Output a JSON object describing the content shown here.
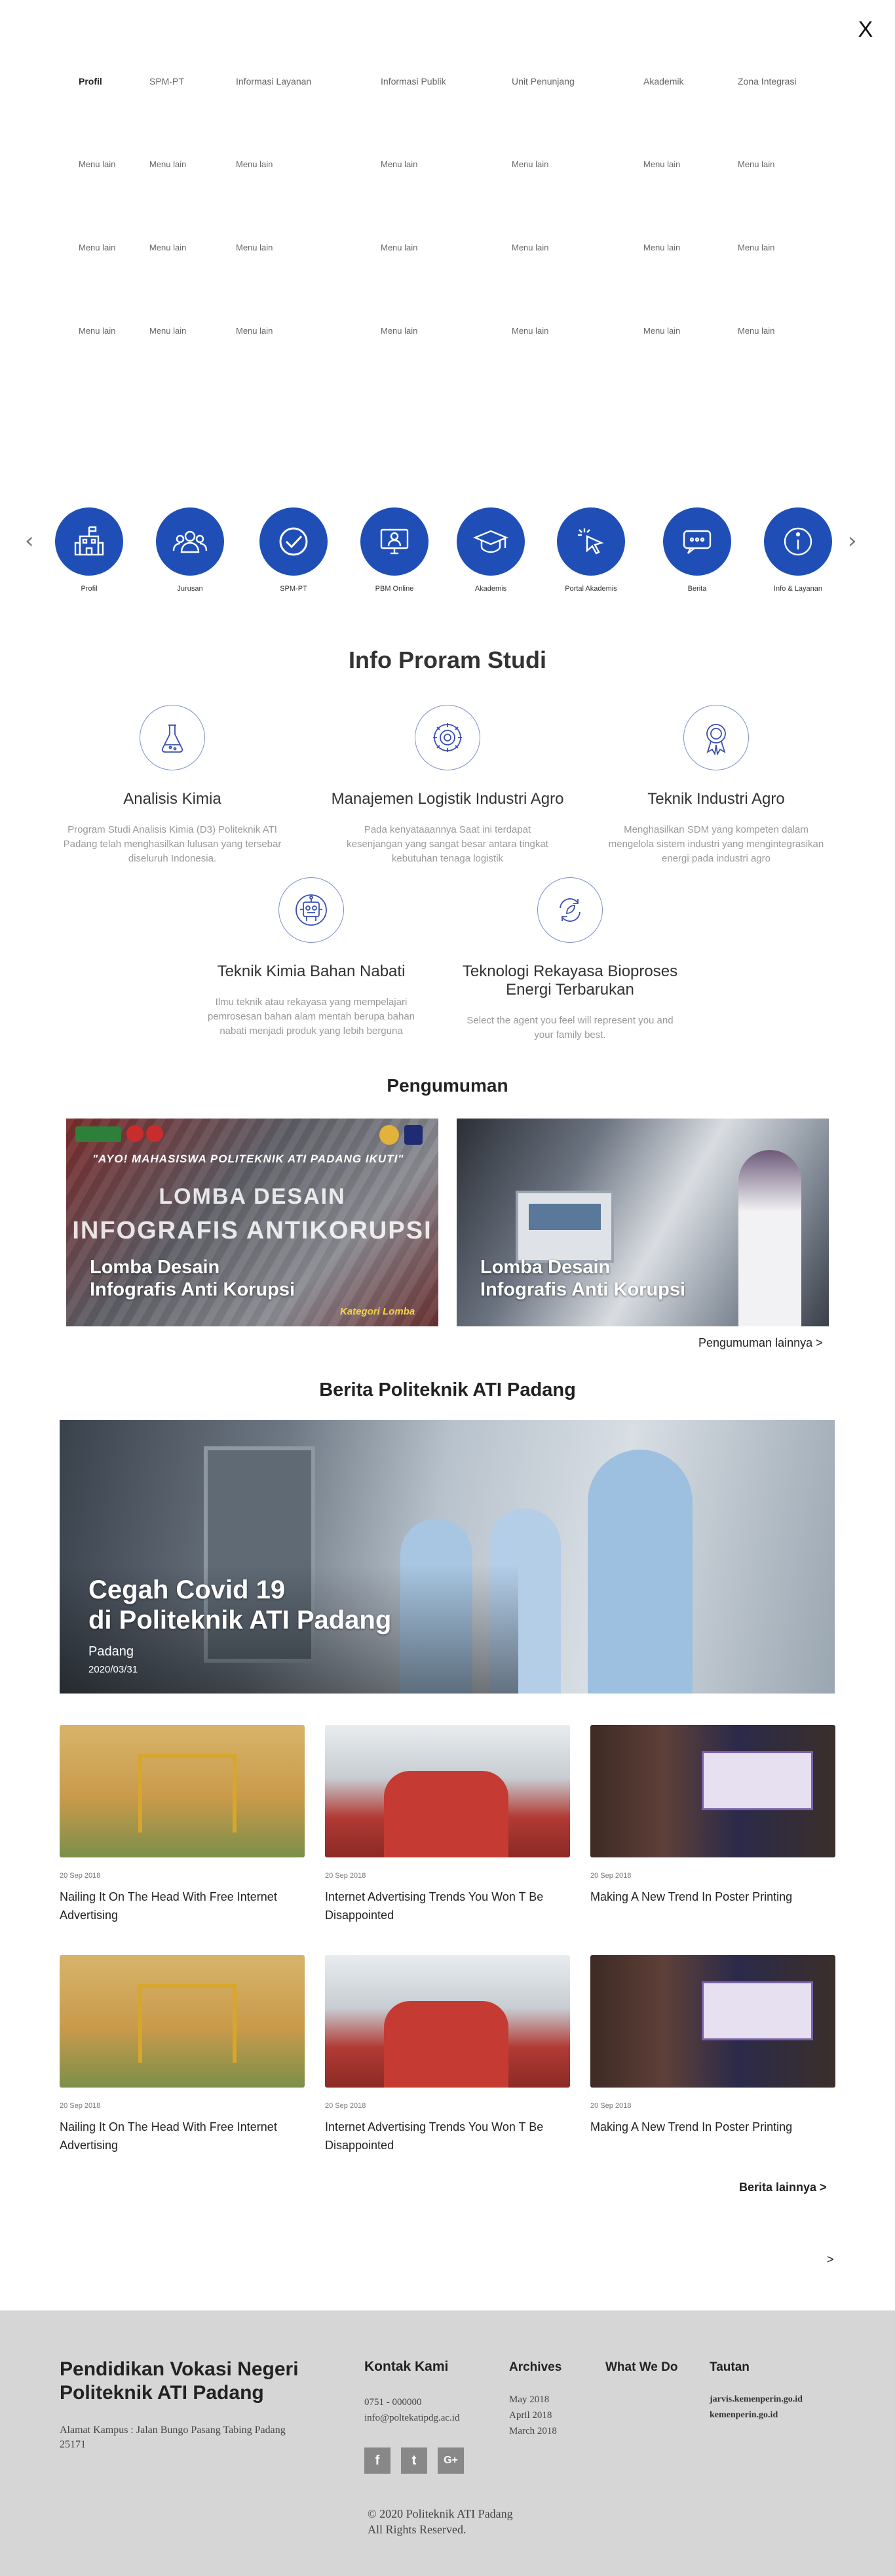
{
  "menu": {
    "close": "X",
    "columns": [
      {
        "head": "Profil",
        "active": true,
        "items": [
          "Menu lain",
          "Menu lain",
          "Menu lain"
        ]
      },
      {
        "head": "SPM-PT",
        "items": [
          "Menu lain",
          "Menu lain",
          "Menu lain"
        ]
      },
      {
        "head": "Informasi Layanan",
        "items": [
          "Menu lain",
          "Menu lain",
          "Menu lain"
        ]
      },
      {
        "head": "Informasi Publik",
        "items": [
          "Menu lain",
          "Menu lain",
          "Menu lain"
        ]
      },
      {
        "head": "Unit Penunjang",
        "items": [
          "Menu lain",
          "Menu lain",
          "Menu lain"
        ]
      },
      {
        "head": "Akademik",
        "items": [
          "Menu lain",
          "Menu lain",
          "Menu lain"
        ]
      },
      {
        "head": "Zona Integrasi",
        "items": [
          "Menu lain",
          "Menu lain",
          "Menu lain"
        ]
      }
    ]
  },
  "quick_links": {
    "prev": "‹",
    "next": "›",
    "items": [
      {
        "label": "Profil",
        "icon": "building-icon"
      },
      {
        "label": "Jurusan",
        "icon": "people-icon"
      },
      {
        "label": "SPM-PT",
        "icon": "check-icon"
      },
      {
        "label": "PBM Online",
        "icon": "computer-user-icon"
      },
      {
        "label": "Akademis",
        "icon": "graduation-cap-icon"
      },
      {
        "label": "Portal Akademis",
        "icon": "pointer-click-icon"
      },
      {
        "label": "Berita",
        "icon": "chat-bubble-icon"
      },
      {
        "label": "Info & Layanan",
        "icon": "info-icon"
      }
    ]
  },
  "programs": {
    "title": "Info Proram Studi",
    "items": [
      {
        "title": "Analisis Kimia",
        "desc": "Program Studi Analisis Kimia (D3) Politeknik ATI Padang telah menghasilkan lulusan yang tersebar diseluruh Indonesia.",
        "icon": "flask-icon"
      },
      {
        "title": "Manajemen Logistik Industri Agro",
        "desc": "Pada kenyataaannya Saat ini terdapat kesenjangan yang sangat besar antara tingkat kebutuhan tenaga logistik",
        "icon": "gear-icon"
      },
      {
        "title": "Teknik Industri Agro",
        "desc": "Menghasilkan SDM yang kompeten dalam mengelola sistem industri yang mengintegrasikan energi pada industri agro",
        "icon": "award-icon"
      },
      {
        "title": "Teknik Kimia Bahan Nabati",
        "desc": "Ilmu teknik atau rekayasa yang mempelajari pemrosesan bahan alam mentah berupa bahan nabati menjadi produk yang lebih berguna",
        "icon": "robot-icon"
      },
      {
        "title": "Teknologi Rekayasa Bioproses Energi Terbarukan",
        "desc": "Select the agent you feel will represent you and your family best.",
        "icon": "recycle-icon"
      }
    ]
  },
  "announcements": {
    "title": "Pengumuman",
    "items": [
      {
        "caption_line1": "Lomba Desain",
        "caption_line2": "Infografis Anti Korupsi",
        "poster_top": "\"AYO! MAHASISWA POLITEKNIK ATI PADANG IKUTI\"",
        "poster_main1": "LOMBA DESAIN",
        "poster_main2": "INFOGRAFIS ANTIKORUPSI",
        "poster_tag": "Kategori Lomba"
      },
      {
        "caption_line1": "Lomba Desain",
        "caption_line2": "Infografis Anti Korupsi"
      }
    ],
    "more": "Pengumuman lainnya  >"
  },
  "news": {
    "title": "Berita Politeknik ATI Padang",
    "featured": {
      "title_line1": "Cegah Covid 19",
      "title_line2": "di Politeknik ATI Padang",
      "location": "Padang",
      "date": "2020/03/31"
    },
    "items": [
      {
        "date": "20 Sep 2018",
        "title": "Nailing It On The Head With Free Internet Advertising"
      },
      {
        "date": "20 Sep 2018",
        "title": "Internet Advertising Trends You Won T Be Disappointed"
      },
      {
        "date": "20 Sep 2018",
        "title": "Making A New Trend In Poster Printing"
      },
      {
        "date": "20 Sep 2018",
        "title": "Nailing It On The Head With Free Internet Advertising"
      },
      {
        "date": "20 Sep 2018",
        "title": "Internet Advertising Trends You Won T Be Disappointed"
      },
      {
        "date": "20 Sep 2018",
        "title": "Making A New Trend In Poster Printing"
      }
    ],
    "more": "Berita lainnya  >",
    "next": ">"
  },
  "footer": {
    "brand_line1": "Pendidikan Vokasi Negeri",
    "brand_line2": "Politeknik ATI Padang",
    "address": "Alamat Kampus : Jalan Bungo Pasang Tabing Padang 25171",
    "contact_head": "Kontak Kami",
    "phone": "0751 - 000000",
    "email": "info@poltekatipdg.ac.id",
    "archives_head": "Archives",
    "archives": [
      "May 2018",
      "April 2018",
      "March 2018"
    ],
    "whatwedo_head": "What We Do",
    "links_head": "Tautan",
    "links": [
      "jarvis.kemenperin.go.id",
      "kemenperin.go.id"
    ],
    "social": [
      "f",
      "t",
      "G+"
    ],
    "copyright_line1": "© 2020 Politeknik ATI Padang",
    "copyright_line2": "All Rights Reserved."
  },
  "colors": {
    "brand_blue": "#1f4fb6",
    "footer_bg": "#d6d6d6"
  }
}
